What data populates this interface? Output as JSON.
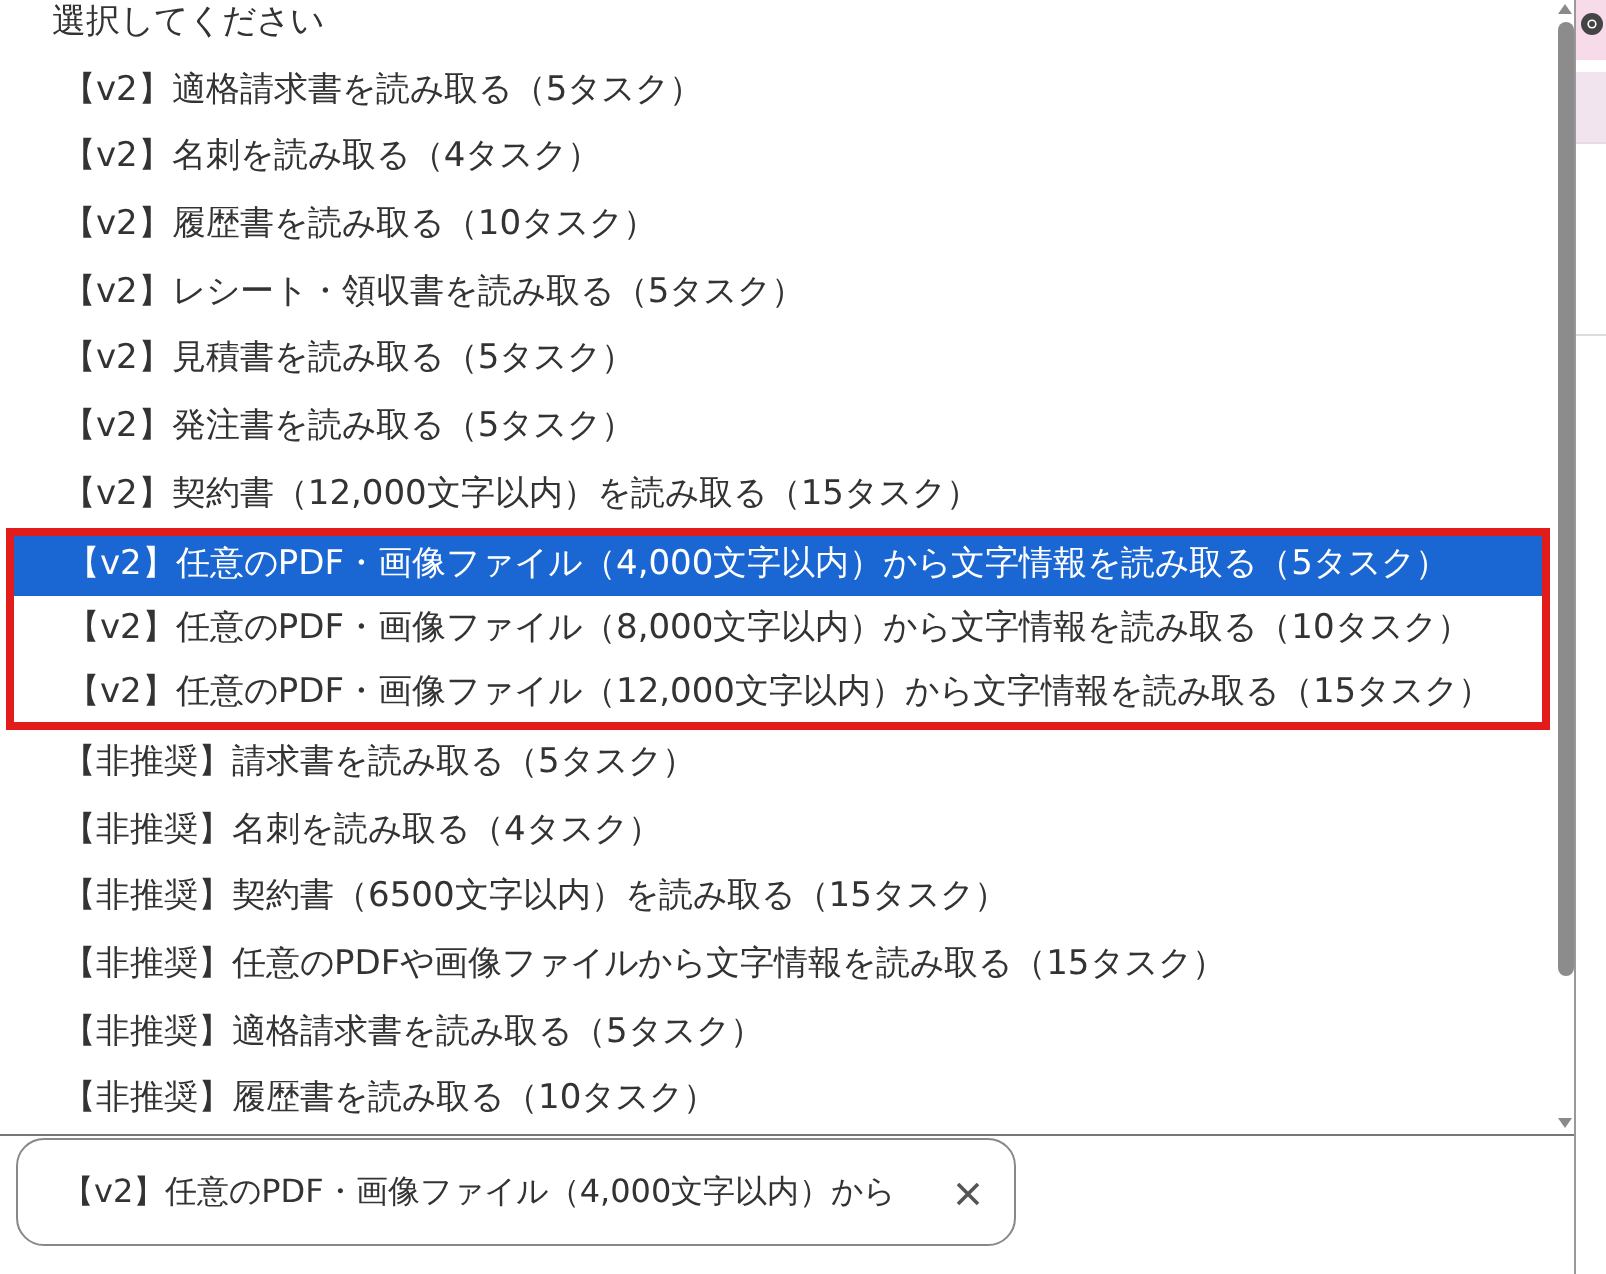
{
  "dropdown": {
    "placeholder": "選択してください",
    "options": [
      {
        "label": "【v2】適格請求書を読み取る（5タスク）",
        "selected": false,
        "framed": false
      },
      {
        "label": "【v2】名刺を読み取る（4タスク）",
        "selected": false,
        "framed": false
      },
      {
        "label": "【v2】履歴書を読み取る（10タスク）",
        "selected": false,
        "framed": false
      },
      {
        "label": "【v2】レシート・領収書を読み取る（5タスク）",
        "selected": false,
        "framed": false
      },
      {
        "label": "【v2】見積書を読み取る（5タスク）",
        "selected": false,
        "framed": false
      },
      {
        "label": "【v2】発注書を読み取る（5タスク）",
        "selected": false,
        "framed": false
      },
      {
        "label": "【v2】契約書（12,000文字以内）を読み取る（15タスク）",
        "selected": false,
        "framed": false
      },
      {
        "label": "【v2】任意のPDF・画像ファイル（4,000文字以内）から文字情報を読み取る（5タスク）",
        "selected": true,
        "framed": true
      },
      {
        "label": "【v2】任意のPDF・画像ファイル（8,000文字以内）から文字情報を読み取る（10タスク）",
        "selected": false,
        "framed": true
      },
      {
        "label": "【v2】任意のPDF・画像ファイル（12,000文字以内）から文字情報を読み取る（15タスク）",
        "selected": false,
        "framed": true
      },
      {
        "label": "【非推奨】請求書を読み取る（5タスク）",
        "selected": false,
        "framed": false
      },
      {
        "label": "【非推奨】名刺を読み取る（4タスク）",
        "selected": false,
        "framed": false
      },
      {
        "label": "【非推奨】契約書（6500文字以内）を読み取る（15タスク）",
        "selected": false,
        "framed": false
      },
      {
        "label": "【非推奨】任意のPDFや画像ファイルから文字情報を読み取る（15タスク）",
        "selected": false,
        "framed": false
      },
      {
        "label": "【非推奨】適格請求書を読み取る（5タスク）",
        "selected": false,
        "framed": false
      },
      {
        "label": "【非推奨】履歴書を読み取る（10タスク）",
        "selected": false,
        "framed": false
      }
    ]
  },
  "select_field": {
    "value": "【v2】任意のPDF・画像ファイル（4,000文字以内）から"
  }
}
